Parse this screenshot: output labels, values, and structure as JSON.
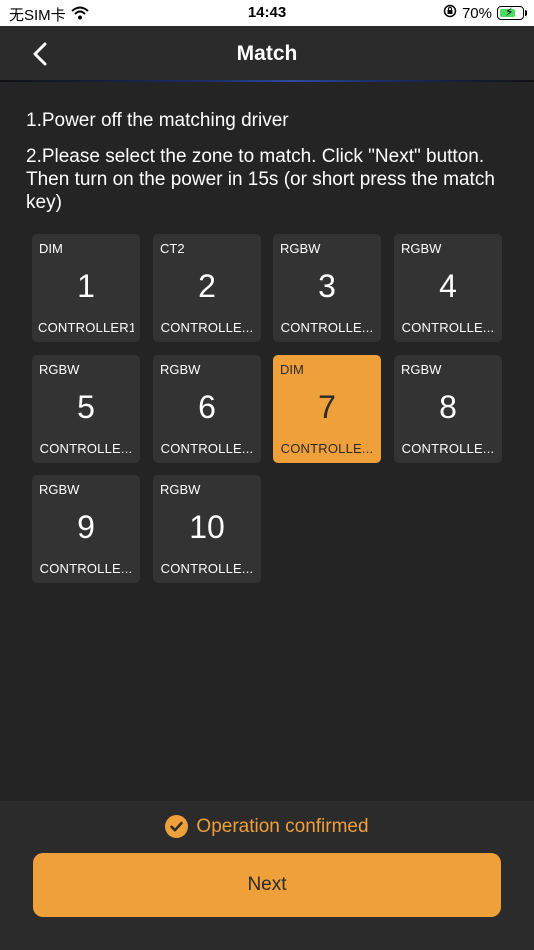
{
  "status_bar": {
    "carrier": "无SIM卡",
    "time": "14:43",
    "battery_percent": "70%",
    "battery_level": 0.7
  },
  "nav": {
    "title": "Match"
  },
  "instructions": {
    "step1": "1.Power off the matching driver",
    "step2": "2.Please select the zone to match. Click \"Next\" button. Then turn on the power in 15s (or short press the match key)"
  },
  "zones": [
    {
      "type": "DIM",
      "number": "1",
      "name": "CONTROLLER1",
      "selected": false
    },
    {
      "type": "CT2",
      "number": "2",
      "name": "CONTROLLE...",
      "selected": false
    },
    {
      "type": "RGBW",
      "number": "3",
      "name": "CONTROLLE...",
      "selected": false
    },
    {
      "type": "RGBW",
      "number": "4",
      "name": "CONTROLLE...",
      "selected": false
    },
    {
      "type": "RGBW",
      "number": "5",
      "name": "CONTROLLE...",
      "selected": false
    },
    {
      "type": "RGBW",
      "number": "6",
      "name": "CONTROLLE...",
      "selected": false
    },
    {
      "type": "DIM",
      "number": "7",
      "name": "CONTROLLE...",
      "selected": true
    },
    {
      "type": "RGBW",
      "number": "8",
      "name": "CONTROLLE...",
      "selected": false
    },
    {
      "type": "RGBW",
      "number": "9",
      "name": "CONTROLLE...",
      "selected": false
    },
    {
      "type": "RGBW",
      "number": "10",
      "name": "CONTROLLE...",
      "selected": false
    }
  ],
  "footer": {
    "confirm_text": "Operation confirmed",
    "next_label": "Next"
  },
  "colors": {
    "accent": "#f0a03a",
    "background": "#242424",
    "tile": "#333333"
  }
}
